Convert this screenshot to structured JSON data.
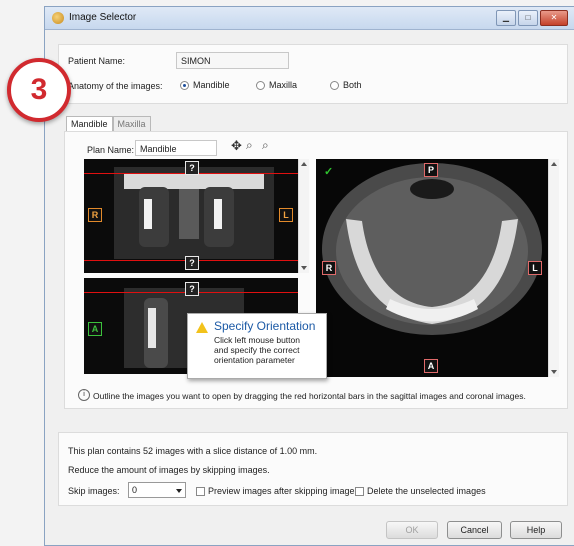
{
  "window": {
    "title": "Image Selector",
    "minimize": "▁",
    "maximize": "□",
    "close": "✕"
  },
  "step_badge": "3",
  "patient": {
    "label": "Patient Name:",
    "value": "SIMON"
  },
  "anatomy": {
    "label": "Anatomy of the images:",
    "options": [
      {
        "label": "Mandible",
        "selected": true
      },
      {
        "label": "Maxilla",
        "selected": false
      },
      {
        "label": "Both",
        "selected": false
      }
    ]
  },
  "tabs": [
    {
      "label": "Mandible",
      "active": true
    },
    {
      "label": "Maxilla",
      "active": false
    }
  ],
  "plan": {
    "label": "Plan Name:",
    "value": "Mandible"
  },
  "tools": {
    "move_icon": "move-icon",
    "zoom_icon": "zoom-in-icon",
    "reset_icon": "zoom-reset-icon"
  },
  "markers": {
    "coronal": {
      "top": "?",
      "bottom": "?",
      "left": "R",
      "right": "L"
    },
    "sagittal": {
      "top": "?",
      "left": "A"
    },
    "axial": {
      "top": "P",
      "left": "R",
      "right": "L",
      "bottom": "A",
      "check": "✓"
    }
  },
  "tooltip": {
    "title": "Specify Orientation",
    "lines": [
      "Click left mouse button",
      "and specify the correct",
      "orientation parameter"
    ]
  },
  "hint": "Outline the images you want to open by dragging the red horizontal bars in the sagittal images and coronal images.",
  "summary": {
    "line1": "This plan contains 52 images with a slice distance of 1.00 mm.",
    "line2": "Reduce the amount of images by skipping images.",
    "skip_label": "Skip images:",
    "skip_value": "0",
    "preview_label": "Preview images after skipping images",
    "delete_label": "Delete the unselected images"
  },
  "buttons": {
    "ok": "OK",
    "cancel": "Cancel",
    "help": "Help"
  }
}
